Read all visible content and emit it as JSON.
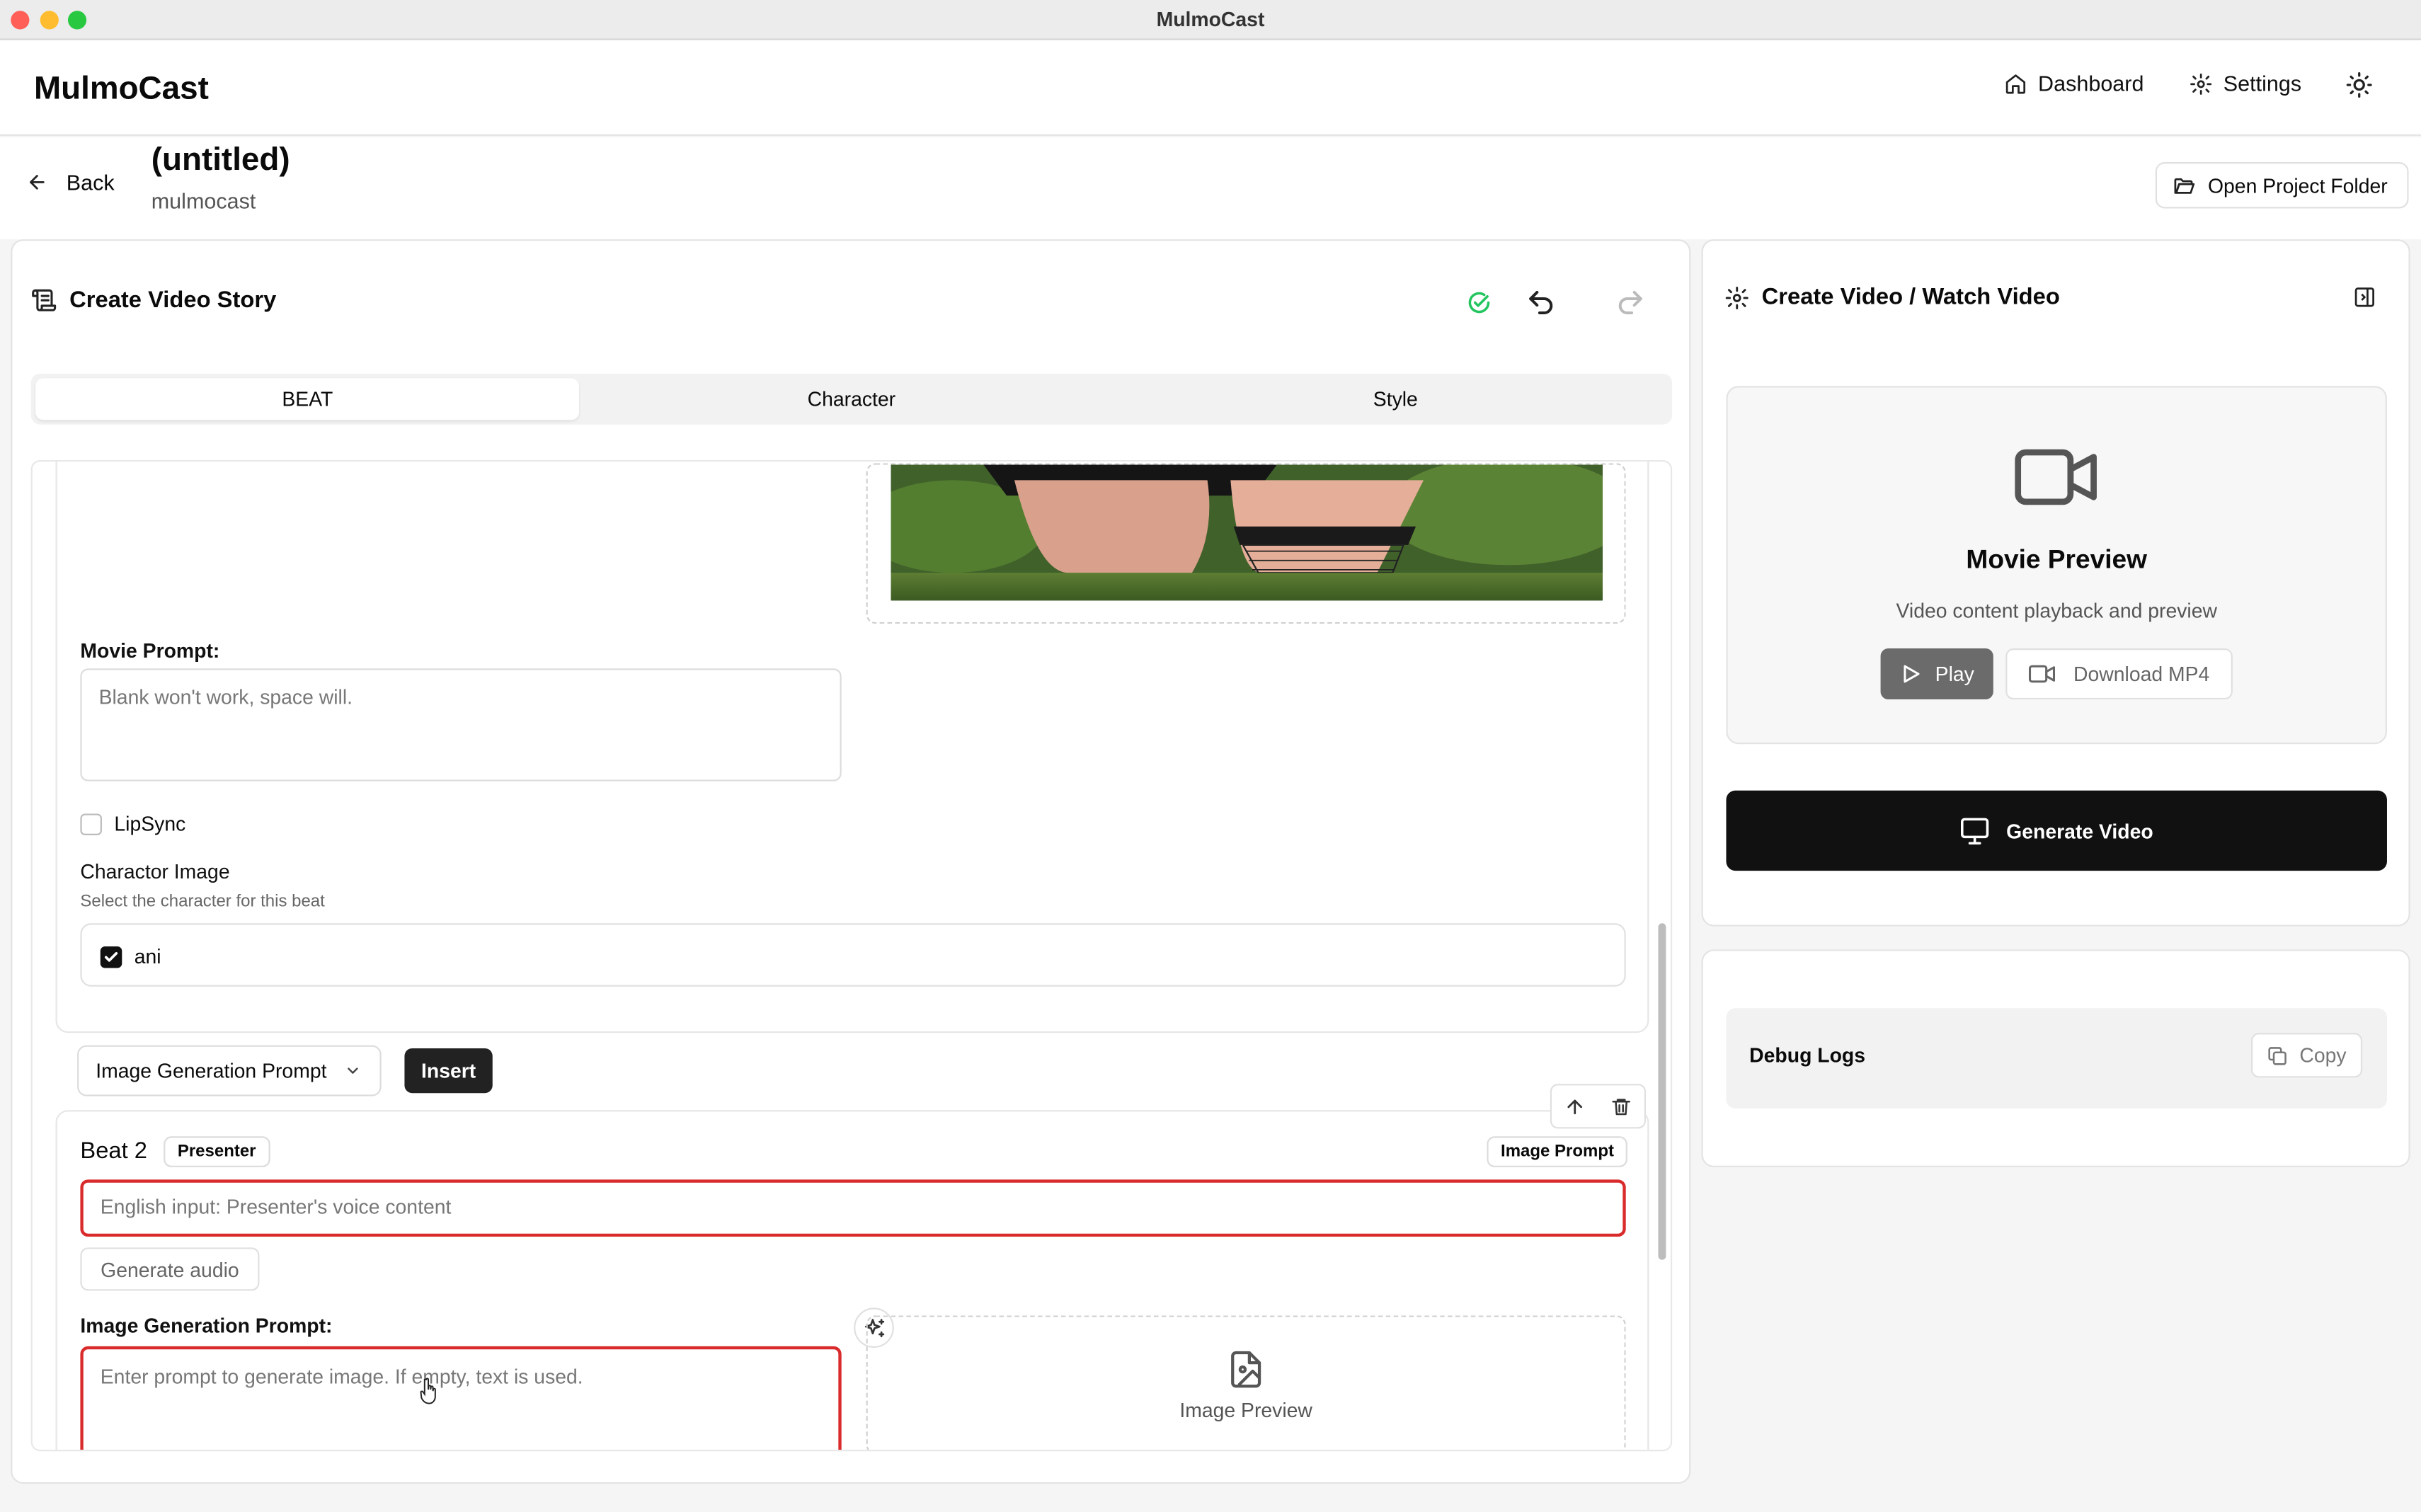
{
  "window": {
    "title": "MulmoCast"
  },
  "header": {
    "brand": "MulmoCast",
    "nav": {
      "dashboard": "Dashboard",
      "settings": "Settings"
    },
    "theme_icon": "sun-icon"
  },
  "project": {
    "back_label": "Back",
    "title": "(untitled)",
    "subtitle": "mulmocast",
    "open_folder_label": "Open Project Folder"
  },
  "left_panel": {
    "title": "Create Video Story",
    "tabs": [
      {
        "label": "BEAT",
        "active": true
      },
      {
        "label": "Character",
        "active": false
      },
      {
        "label": "Style",
        "active": false
      }
    ],
    "beat1": {
      "movie_prompt_label": "Movie Prompt:",
      "movie_prompt_placeholder": "Blank won't work, space will.",
      "lipsync_label": "LipSync",
      "lipsync_checked": false,
      "character_image_label": "Charactor Image",
      "character_image_hint": "Select the character for this beat",
      "characters": [
        {
          "name": "ani",
          "checked": true
        }
      ]
    },
    "insert_bar": {
      "select_value": "Image Generation Prompt",
      "insert_label": "Insert"
    },
    "beat2": {
      "title": "Beat 2",
      "speaker_badge": "Presenter",
      "mode_badge": "Image Prompt",
      "text_placeholder": "English input: Presenter's voice content",
      "generate_audio_label": "Generate audio",
      "image_prompt_label": "Image Generation Prompt:",
      "image_prompt_placeholder": "Enter prompt to generate image. If empty, text is used.",
      "image_preview_label": "Image Preview"
    }
  },
  "right_panel": {
    "title": "Create Video / Watch Video",
    "movie_preview_title": "Movie Preview",
    "movie_preview_subtitle": "Video content playback and preview",
    "play_label": "Play",
    "download_label": "Download MP4",
    "generate_video_label": "Generate Video"
  },
  "debug": {
    "label": "Debug Logs",
    "copy_label": "Copy"
  },
  "colors": {
    "accent": "#111111",
    "error_border": "#d92b2b",
    "saved_indicator": "#22c55e"
  }
}
